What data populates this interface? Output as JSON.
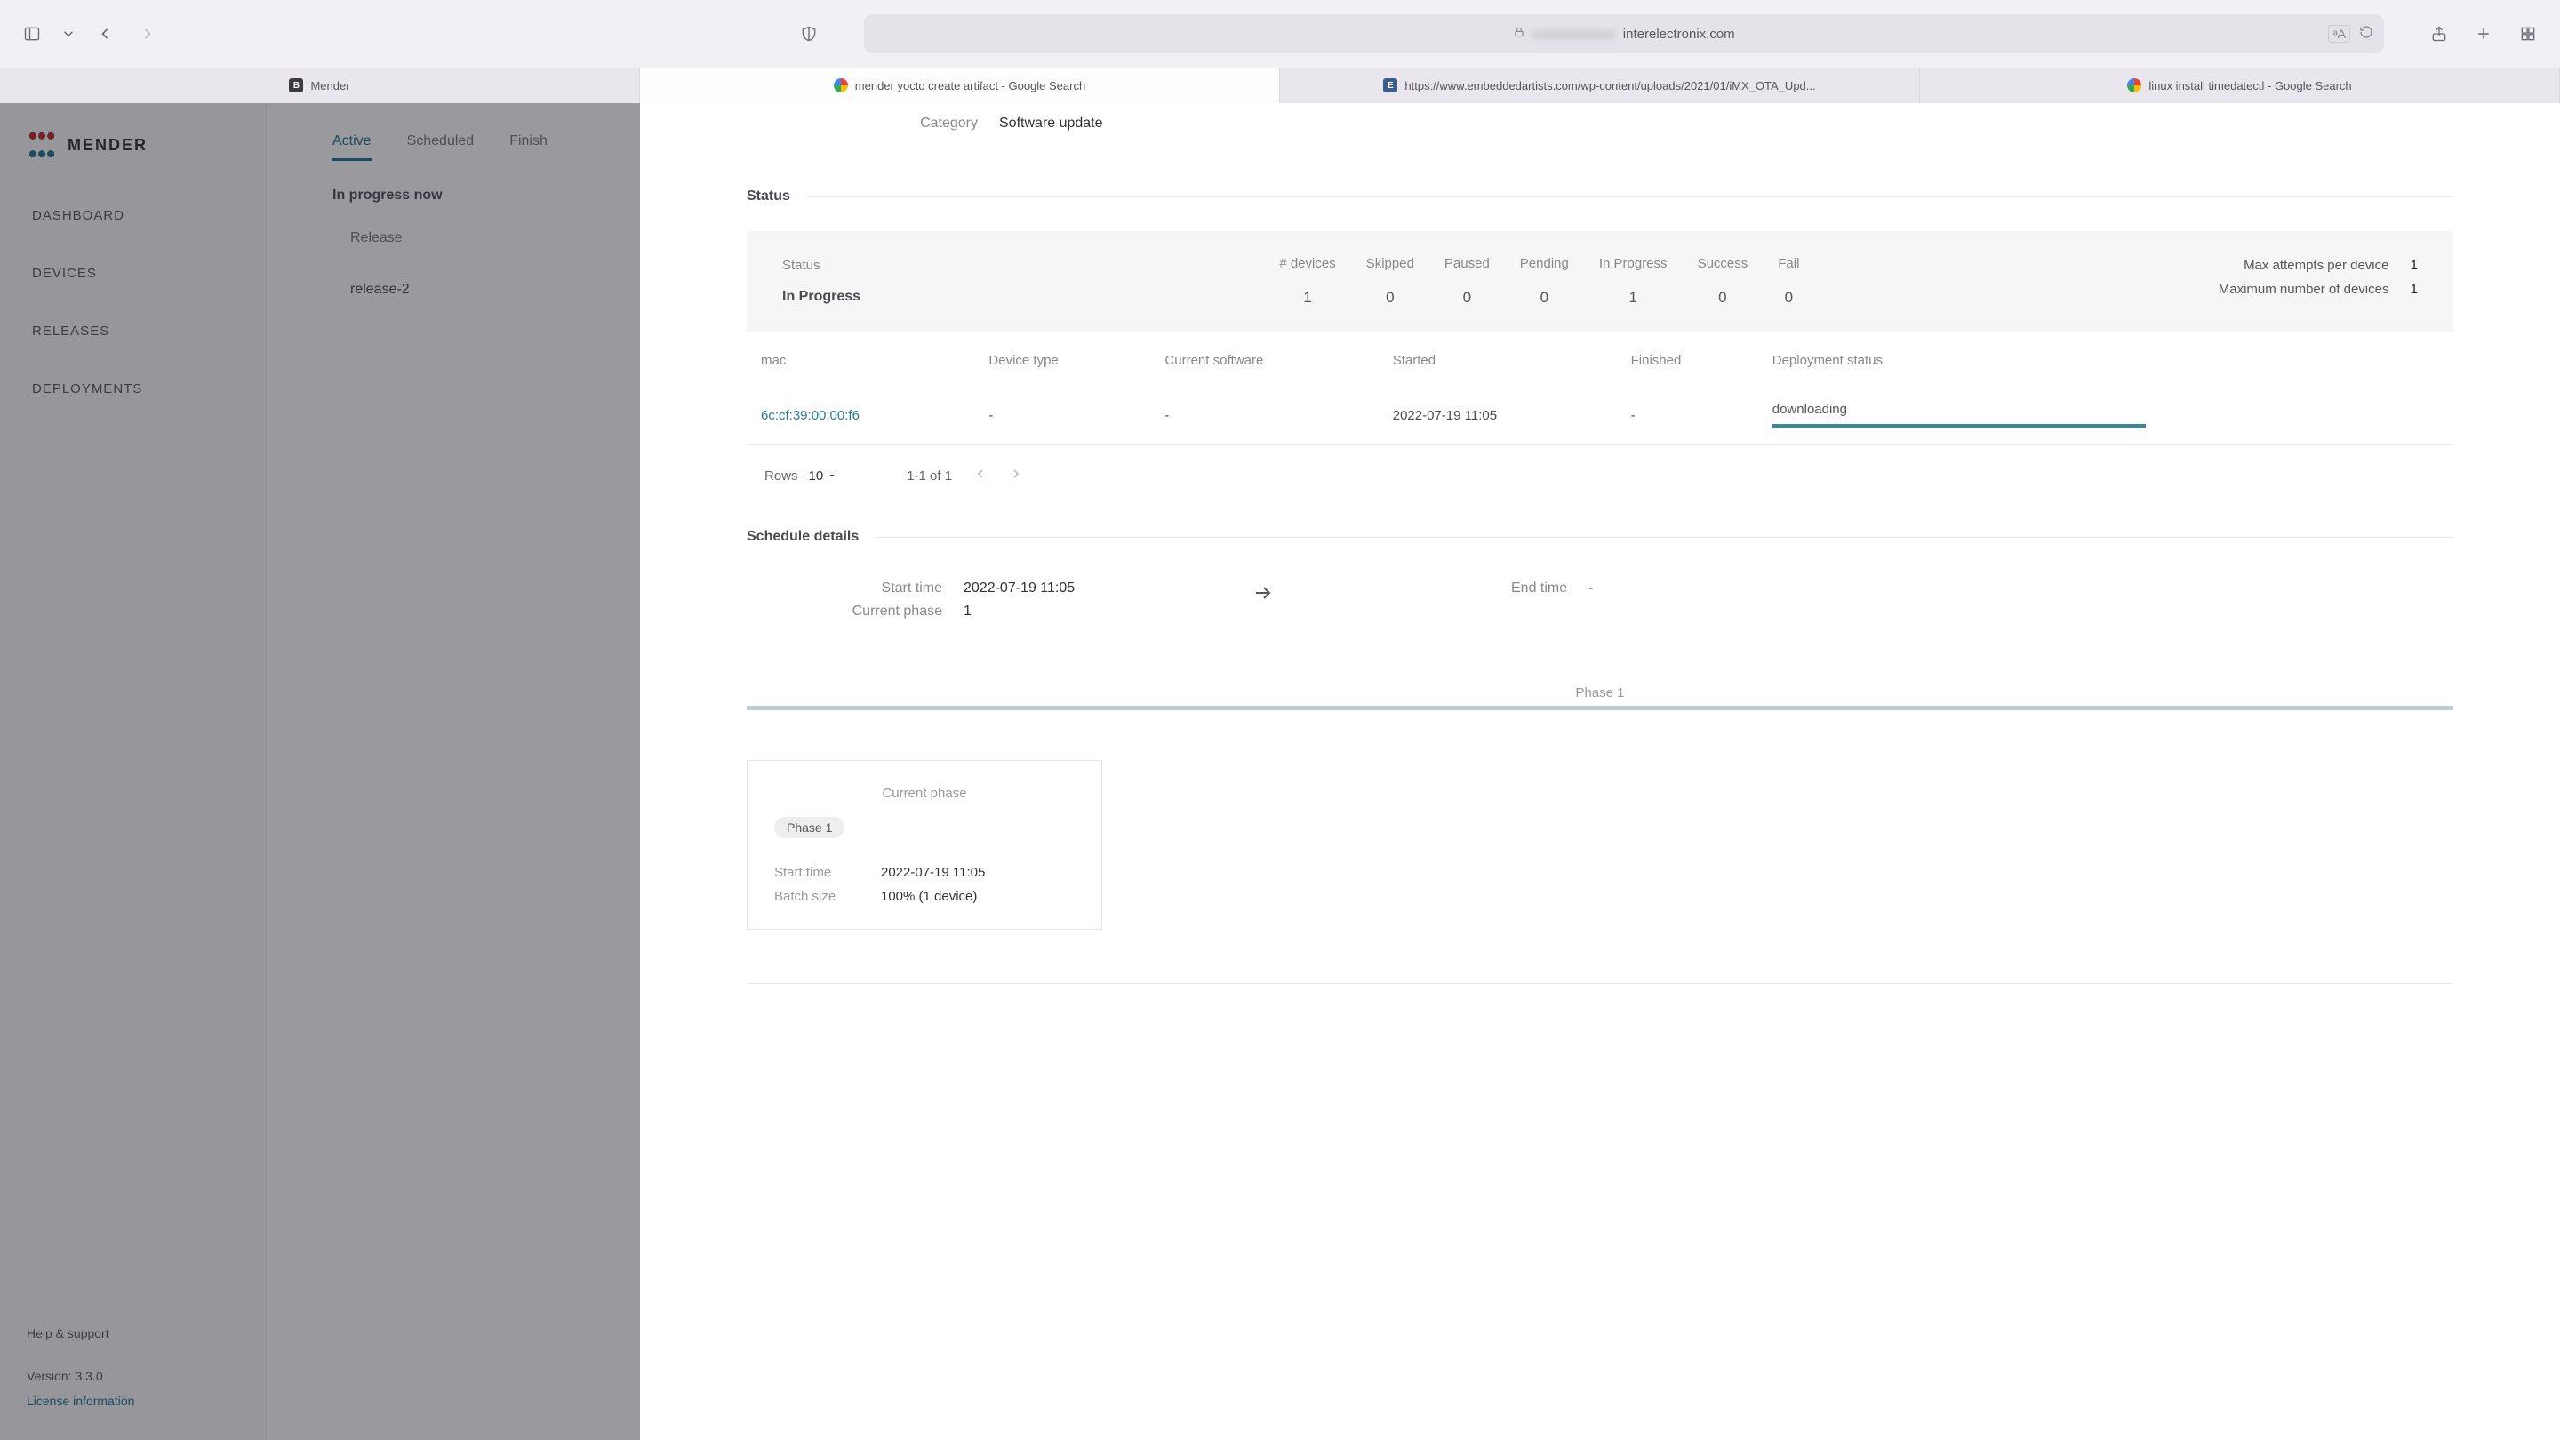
{
  "browser": {
    "url_suffix": "interelectronix.com",
    "tabs": [
      {
        "label": "Mender",
        "favClass": "fav-b"
      },
      {
        "label": "mender yocto create artifact - Google Search",
        "favClass": "fav-g"
      },
      {
        "label": "https://www.embeddedartists.com/wp-content/uploads/2021/01/iMX_OTA_Upd...",
        "favClass": "fav-e"
      },
      {
        "label": "linux install timedatectl - Google Search",
        "favClass": "fav-g"
      }
    ]
  },
  "sidebar": {
    "brand": "MENDER",
    "items": [
      "DASHBOARD",
      "DEVICES",
      "RELEASES",
      "DEPLOYMENTS"
    ],
    "help": "Help & support",
    "version": "Version: 3.3.0",
    "license": "License information"
  },
  "sub_tabs": {
    "active": "Active",
    "scheduled": "Scheduled",
    "finished": "Finish"
  },
  "bg": {
    "heading": "In progress now",
    "release_lbl": "Release",
    "release_val": "release-2"
  },
  "kv": {
    "category_lbl": "Category",
    "category_val": "Software update"
  },
  "status_section": "Status",
  "status": {
    "lbl": "Status",
    "val": "In Progress",
    "hdr_devices": "# devices",
    "hdr_skipped": "Skipped",
    "hdr_paused": "Paused",
    "hdr_pending": "Pending",
    "hdr_inprog": "In Progress",
    "hdr_success": "Success",
    "hdr_fail": "Fail",
    "n_devices": "1",
    "n_skipped": "0",
    "n_paused": "0",
    "n_pending": "0",
    "n_inprog": "1",
    "n_success": "0",
    "n_fail": "0",
    "max_attempts_lbl": "Max attempts per device",
    "max_attempts_val": "1",
    "max_devices_lbl": "Maximum number of devices",
    "max_devices_val": "1"
  },
  "dev_table": {
    "h_mac": "mac",
    "h_devtype": "Device type",
    "h_cursw": "Current software",
    "h_started": "Started",
    "h_finished": "Finished",
    "h_depstat": "Deployment status",
    "rows": [
      {
        "mac": "6c:cf:39:00:00:f6",
        "devtype": "-",
        "cursw": "-",
        "started": "2022-07-19 11:05",
        "finished": "-",
        "depstat": "downloading"
      }
    ]
  },
  "pager": {
    "rows_lbl": "Rows",
    "rows_val": "10",
    "range": "1-1 of 1"
  },
  "sched_section": "Schedule details",
  "sched": {
    "start_lbl": "Start time",
    "start_val": "2022-07-19 11:05",
    "phase_lbl": "Current phase",
    "phase_val": "1",
    "end_lbl": "End time",
    "end_val": "-",
    "phase_bar_label": "Phase 1"
  },
  "phase_card": {
    "title": "Current phase",
    "chip": "Phase 1",
    "start_lbl": "Start time",
    "start_val": "2022-07-19 11:05",
    "batch_lbl": "Batch size",
    "batch_val": "100% (1 device)"
  }
}
